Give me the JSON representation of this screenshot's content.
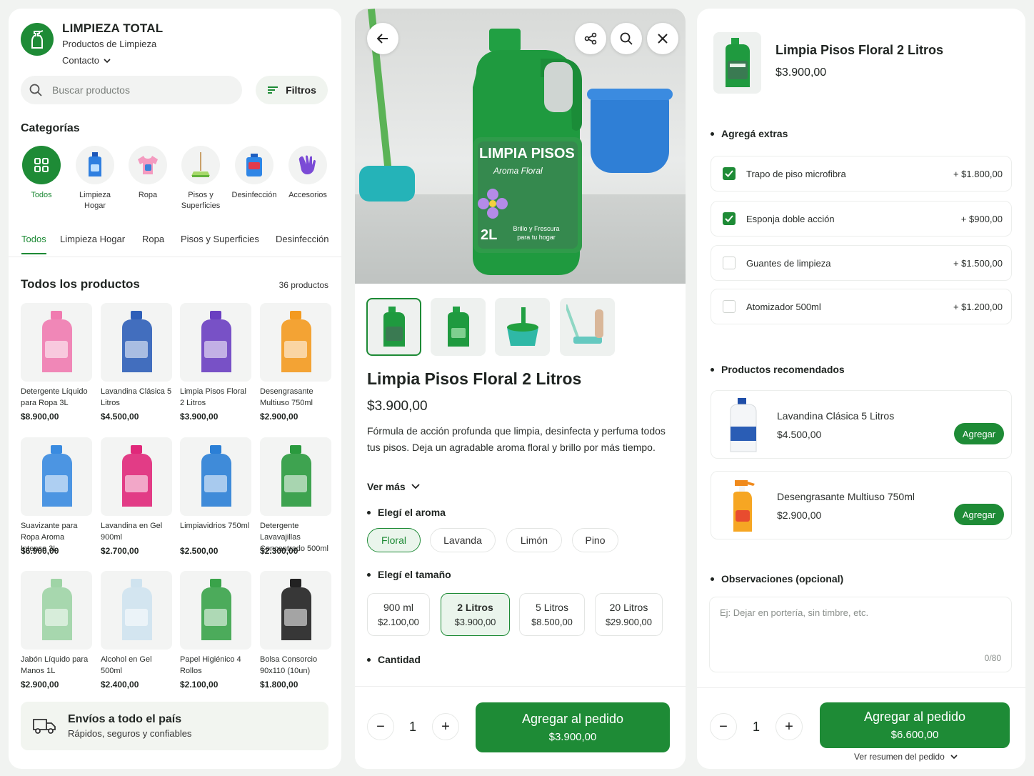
{
  "store": {
    "name": "LIMPIEZA TOTAL",
    "subtitle": "Productos de Limpieza",
    "contact_label": "Contacto",
    "search_placeholder": "Buscar productos",
    "filters_label": "Filtros"
  },
  "categories_title": "Categorías",
  "categories": [
    {
      "label": "Todos",
      "icon": "grid-icon",
      "active": true
    },
    {
      "label": "Limpieza Hogar",
      "icon": "detergent-bottle-icon"
    },
    {
      "label": "Ropa",
      "icon": "shirt-icon"
    },
    {
      "label": "Pisos y Superficies",
      "icon": "mop-icon"
    },
    {
      "label": "Desinfección",
      "icon": "disinfectant-icon"
    },
    {
      "label": "Accesorios",
      "icon": "glove-icon"
    }
  ],
  "tabs": [
    "Todos",
    "Limpieza Hogar",
    "Ropa",
    "Pisos y Superficies",
    "Desinfección"
  ],
  "products_title": "Todos los productos",
  "products_count": "36 productos",
  "products": [
    {
      "name": "Detergente Líquido para Ropa 3L",
      "price": "$8.900,00",
      "color": "#f07bb0"
    },
    {
      "name": "Lavandina Clásica 5 Litros",
      "price": "$4.500,00",
      "color": "#2f5fb8"
    },
    {
      "name": "Limpia Pisos Floral 2 Litros",
      "price": "$3.900,00",
      "color": "#6a3fc1"
    },
    {
      "name": "Desengrasante Multiuso 750ml",
      "price": "$2.900,00",
      "color": "#f39a1f"
    },
    {
      "name": "Suavizante para Ropa Aroma Intenso 3L",
      "price": "$6.900,00",
      "color": "#3a8be0"
    },
    {
      "name": "Lavandina en Gel 900ml",
      "price": "$2.700,00",
      "color": "#e0287a"
    },
    {
      "name": "Limpiavidrios 750ml",
      "price": "$2.500,00",
      "color": "#2b7fd6"
    },
    {
      "name": "Detergente Lavavajillas Concentrado 500ml",
      "price": "$2.300,00",
      "color": "#2a9a3e"
    },
    {
      "name": "Jabón Líquido para Manos 1L",
      "price": "$2.900,00",
      "color": "#9fd4a6"
    },
    {
      "name": "Alcohol en Gel 500ml",
      "price": "$2.400,00",
      "color": "#cfe3ef"
    },
    {
      "name": "Papel Higiénico 4 Rollos",
      "price": "$2.100,00",
      "color": "#3aa34a"
    },
    {
      "name": "Bolsa Consorcio 90x110 (10un)",
      "price": "$1.800,00",
      "color": "#222222"
    }
  ],
  "shipping": {
    "title": "Envíos a todo el país",
    "subtitle": "Rápidos, seguros y confiables"
  },
  "product": {
    "label_title": "LIMPIA PISOS",
    "label_sub": "Aroma Floral",
    "label_size": "2L",
    "label_tag": "Brillo y Frescura para tu hogar",
    "title": "Limpia Pisos Floral 2 Litros",
    "price": "$3.900,00",
    "description": "Fórmula de acción profunda que limpia, desinfecta y perfuma todos tus pisos. Deja un agradable aroma floral y brillo por más tiempo.",
    "see_more": "Ver más",
    "aroma_title": "Elegí el aroma",
    "aromas": [
      "Floral",
      "Lavanda",
      "Limón",
      "Pino"
    ],
    "size_title": "Elegí el tamaño",
    "sizes": [
      {
        "label": "900 ml",
        "price": "$2.100,00"
      },
      {
        "label": "2 Litros",
        "price": "$3.900,00"
      },
      {
        "label": "5 Litros",
        "price": "$8.500,00"
      },
      {
        "label": "20 Litros",
        "price": "$29.900,00"
      }
    ],
    "quantity_title": "Cantidad",
    "quantity": "1",
    "cta_label": "Agregar al pedido",
    "cta_price": "$3.900,00"
  },
  "summary": {
    "title": "Limpia Pisos Floral 2 Litros",
    "price": "$3.900,00",
    "extras_title": "Agregá extras",
    "extras": [
      {
        "name": "Trapo de piso microfibra",
        "price": "+ $1.800,00",
        "checked": true
      },
      {
        "name": "Esponja doble acción",
        "price": "+ $900,00",
        "checked": true
      },
      {
        "name": "Guantes de limpieza",
        "price": "+ $1.500,00",
        "checked": false
      },
      {
        "name": "Atomizador 500ml",
        "price": "+ $1.200,00",
        "checked": false
      }
    ],
    "recommended_title": "Productos recomendados",
    "recommended": [
      {
        "name": "Lavandina Clásica 5 Litros",
        "price": "$4.500,00",
        "button": "Agregar"
      },
      {
        "name": "Desengrasante Multiuso 750ml",
        "price": "$2.900,00",
        "button": "Agregar"
      }
    ],
    "notes_title": "Observaciones (opcional)",
    "notes_placeholder": "Ej: Dejar en portería, sin timbre, etc.",
    "notes_count": "0/80",
    "quantity": "1",
    "cta_label": "Agregar al pedido",
    "cta_price": "$6.600,00",
    "summary_link": "Ver resumen del pedido"
  },
  "colors": {
    "accent": "#1e8b36",
    "accent_light": "#eaf5ec"
  }
}
